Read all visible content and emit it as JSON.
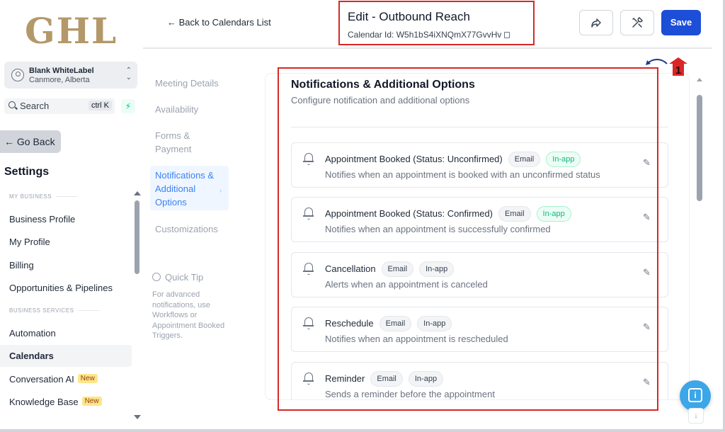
{
  "brand": {
    "logo_text": "GHL"
  },
  "account": {
    "name": "Blank WhiteLabel",
    "location": "Canmore, Alberta"
  },
  "search": {
    "label": "Search",
    "shortcut": "ctrl K"
  },
  "nav": {
    "go_back": "Go Back",
    "settings_title": "Settings",
    "section_my_business": "MY BUSINESS",
    "section_business_services": "BUSINESS SERVICES",
    "items": [
      {
        "label": "Business Profile"
      },
      {
        "label": "My Profile"
      },
      {
        "label": "Billing"
      },
      {
        "label": "Opportunities & Pipelines"
      },
      {
        "label": "Automation"
      },
      {
        "label": "Calendars"
      },
      {
        "label": "Conversation AI",
        "badge": "New"
      },
      {
        "label": "Knowledge Base",
        "badge": "New"
      }
    ]
  },
  "header": {
    "back_label": "Back to Calendars List",
    "title": "Edit - Outbound Reach",
    "calendar_id": "Calendar Id: W5h1bS4iXNQmX77GvvHv",
    "save_label": "Save"
  },
  "section_nav": {
    "items": [
      {
        "label": "Meeting Details"
      },
      {
        "label": "Availability"
      },
      {
        "label": "Forms &",
        "label2": "Payment"
      },
      {
        "label": "Notifications &",
        "label2": "Additional",
        "label3": "Options"
      },
      {
        "label": "Customizations"
      }
    ],
    "quick_tip": {
      "title": "Quick Tip",
      "body": "For advanced notifications, use Workflows or Appointment Booked Triggers."
    }
  },
  "card": {
    "title": "Notifications & Additional Options",
    "subtitle": "Configure notification and additional options",
    "notifications": [
      {
        "name": "Appointment Booked (Status: Unconfirmed)",
        "desc": "Notifies when an appointment is booked with an unconfirmed status",
        "email": "Email",
        "inapp": "In-app",
        "inapp_on": true
      },
      {
        "name": "Appointment Booked (Status: Confirmed)",
        "desc": "Notifies when an appointment is successfully confirmed",
        "email": "Email",
        "inapp": "In-app",
        "inapp_on": true
      },
      {
        "name": "Cancellation",
        "desc": "Alerts when an appointment is canceled",
        "email": "Email",
        "inapp": "In-app",
        "inapp_on": false
      },
      {
        "name": "Reschedule",
        "desc": "Notifies when an appointment is rescheduled",
        "email": "Email",
        "inapp": "In-app",
        "inapp_on": false
      },
      {
        "name": "Reminder",
        "desc": "Sends a reminder before the appointment",
        "email": "Email",
        "inapp": "In-app",
        "inapp_on": false
      }
    ]
  },
  "annotation": {
    "marker_number": "1"
  },
  "colors": {
    "accent": "#1d4ed8",
    "highlight": "#d62828",
    "success": "#10b981",
    "logo": "#b39869"
  }
}
